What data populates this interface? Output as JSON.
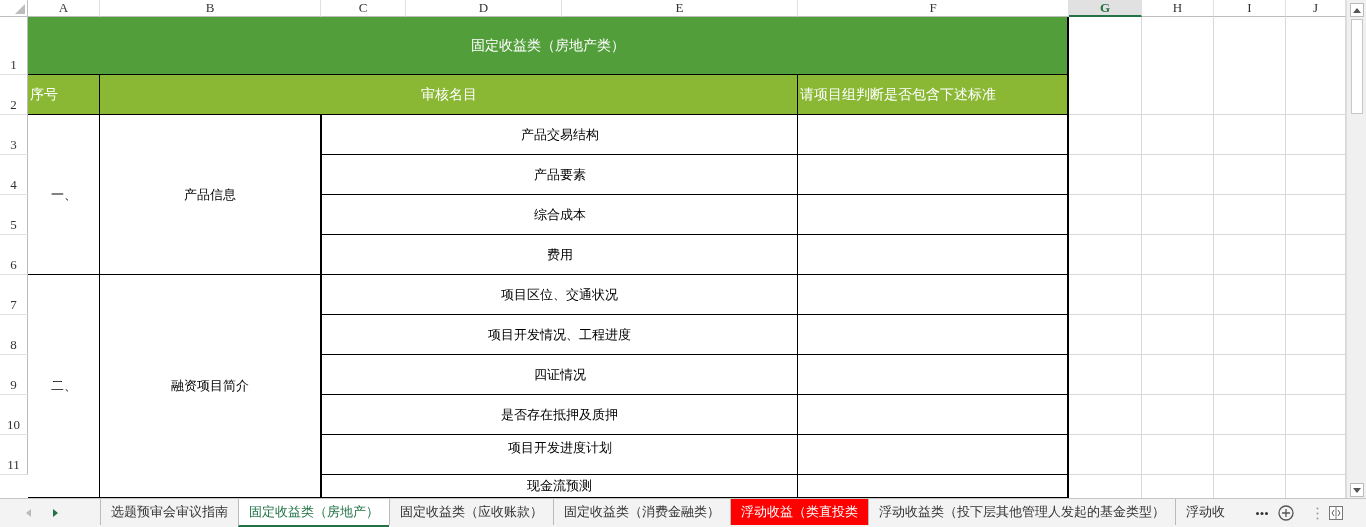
{
  "columns": [
    {
      "label": "A",
      "selected": false
    },
    {
      "label": "B",
      "selected": false
    },
    {
      "label": "C",
      "selected": false
    },
    {
      "label": "D",
      "selected": false
    },
    {
      "label": "E",
      "selected": false
    },
    {
      "label": "F",
      "selected": false
    },
    {
      "label": "G",
      "selected": true
    },
    {
      "label": "H",
      "selected": false
    },
    {
      "label": "I",
      "selected": false
    },
    {
      "label": "J",
      "selected": false
    }
  ],
  "rows": [
    "1",
    "2",
    "3",
    "4",
    "5",
    "6",
    "7",
    "8",
    "9",
    "10",
    "11"
  ],
  "title": "固定收益类（房地产类）",
  "header": {
    "number": "序号",
    "item": "审核名目",
    "criteria": "请项目组判断是否包含下述标准"
  },
  "sections": [
    {
      "number": "一、",
      "name": "产品信息",
      "items": [
        "产品交易结构",
        "产品要素",
        "综合成本",
        "费用"
      ]
    },
    {
      "number": "二、",
      "name": "融资项目简介",
      "items": [
        "项目区位、交通状况",
        "项目开发情况、工程进度",
        "四证情况",
        "是否存在抵押及质押",
        "项目开发进度计划",
        "现金流预测"
      ]
    }
  ],
  "sheet_tabs": [
    {
      "label": "选题预审会审议指南",
      "selected": false
    },
    {
      "label": "固定收益类（房地产）",
      "selected": true
    },
    {
      "label": "固定收益类（应收账款）",
      "selected": false
    },
    {
      "label": "固定收益类（消费金融类）",
      "selected": false
    },
    {
      "label": "浮动收益（类直投类",
      "selected": false,
      "color": "#ff0000"
    },
    {
      "label": "浮动收益类（投下层其他管理人发起的基金类型）",
      "selected": false
    },
    {
      "label": "浮动收",
      "selected": false
    }
  ]
}
